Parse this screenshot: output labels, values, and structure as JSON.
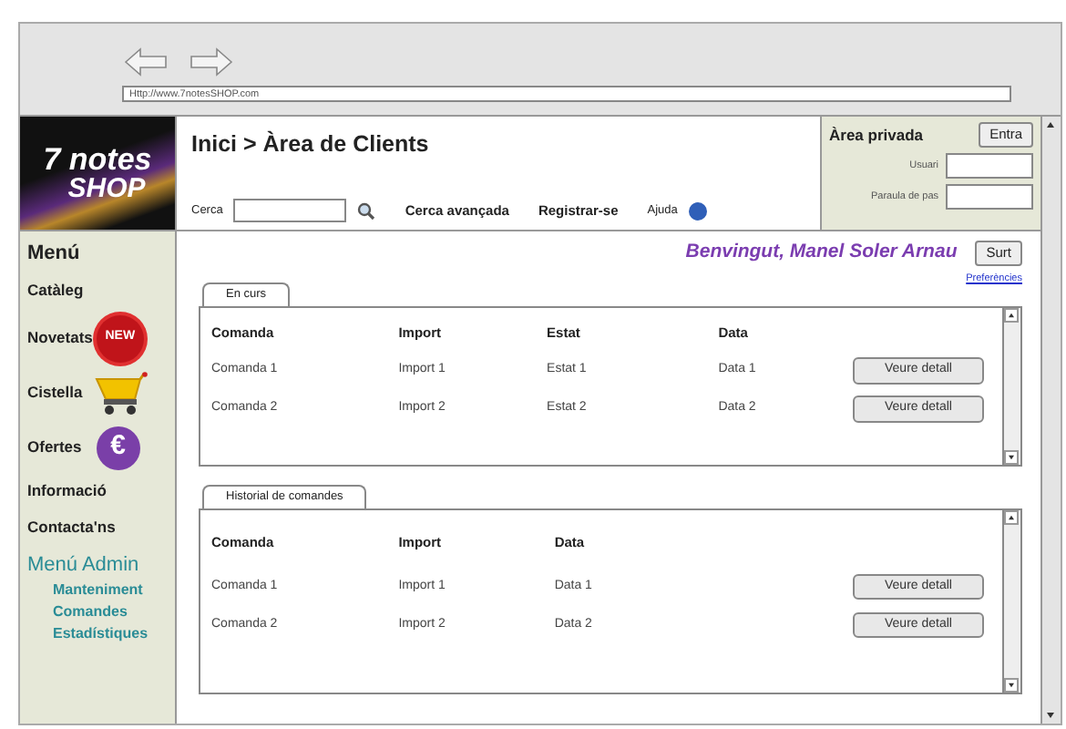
{
  "browser": {
    "url": "Http://www.7notesSHOP.com"
  },
  "logo": {
    "line_1": "7 notes",
    "line_2": "SHOP"
  },
  "header": {
    "breadcrumb": "Inici > Àrea de Clients",
    "search_label": "Cerca",
    "links": [
      "Cerca avançada",
      "Registrar-se"
    ],
    "help": "Ajuda"
  },
  "private_area": {
    "title": "Àrea privada",
    "button": "Entra",
    "fields": [
      {
        "label": "Usuari"
      },
      {
        "label": "Paraula de pas"
      }
    ]
  },
  "sidebar": {
    "title": "Menú",
    "items": [
      {
        "label": "Catàleg",
        "kind": "plain"
      },
      {
        "label": "Novetats",
        "kind": "new",
        "badge": "NEW"
      },
      {
        "label": "Cistella",
        "kind": "cart"
      },
      {
        "label": "Ofertes",
        "kind": "euro",
        "badge": "€"
      },
      {
        "label": "Informació",
        "kind": "plain"
      },
      {
        "label": "Contacta'ns",
        "kind": "plain"
      }
    ],
    "admin_title": "Menú Admin",
    "admin_items": [
      "Manteniment",
      "Comandes",
      "Estadístiques"
    ]
  },
  "welcome": {
    "text": "Benvingut, Manel Soler Arnau",
    "button": "Surt",
    "link": "Preferències"
  },
  "panels": [
    {
      "tab": "En curs",
      "columns": [
        "Comanda",
        "Import",
        "Estat",
        "Data"
      ],
      "rows": [
        {
          "cells": [
            "Comanda 1",
            "Import 1",
            "Estat 1",
            "Data 1"
          ],
          "action": "Veure detall"
        },
        {
          "cells": [
            "Comanda 2",
            "Import 2",
            "Estat 2",
            "Data 2"
          ],
          "action": "Veure detall"
        }
      ]
    },
    {
      "tab": "Historial de comandes",
      "columns": [
        "Comanda",
        "Import",
        "Data"
      ],
      "rows": [
        {
          "cells": [
            "Comanda 1",
            "Import 1",
            "Data 1"
          ],
          "action": "Veure detall"
        },
        {
          "cells": [
            "Comanda 2",
            "Import 2",
            "Data 2"
          ],
          "action": "Veure detall"
        }
      ]
    }
  ]
}
